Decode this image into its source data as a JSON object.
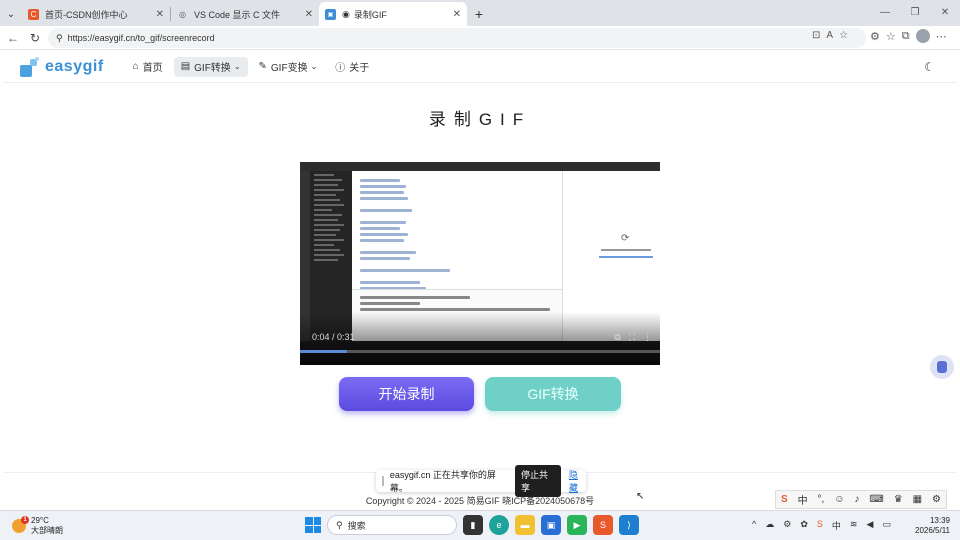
{
  "browser": {
    "tabs": [
      {
        "title": "首页-CSDN创作中心",
        "fav_color": "#e85a2c",
        "fav_glyph": "C"
      },
      {
        "title": "VS Code 显示 C 文件",
        "fav_color": "#555555",
        "fav_glyph": "◎"
      },
      {
        "title": "录制GIF",
        "fav_color": "#3d8fd6",
        "fav_glyph": "▣"
      }
    ],
    "url": "https://easygif.cn/to_gif/screenrecord"
  },
  "site": {
    "logo": "easygif",
    "nav": [
      {
        "label": "首页",
        "icon": "home-icon"
      },
      {
        "label": "GIF转换",
        "icon": "image-icon",
        "active": true
      },
      {
        "label": "GIF变换",
        "icon": "wand-icon"
      },
      {
        "label": "关于",
        "icon": "info-icon"
      }
    ],
    "title": "录制GIF",
    "video_time": "0:04 / 0:31",
    "video_progress": 0.13,
    "buttons": {
      "record": "开始录制",
      "convert": "GIF转换"
    },
    "share_bar": {
      "text": "easygif.cn 正在共享你的屏幕。",
      "stop": "停止共享",
      "hide": "隐藏"
    },
    "copyright": "Copyright © 2024 - 2025 简易GIF 晓ICP备2024050678号"
  },
  "taskbar": {
    "weather_temp": "29°C",
    "weather_desc": "大部晴朗",
    "weather_badge": "1",
    "search": "搜索",
    "time": "13:39",
    "date": "2026/5/11"
  },
  "ime": {
    "mode": "中"
  }
}
